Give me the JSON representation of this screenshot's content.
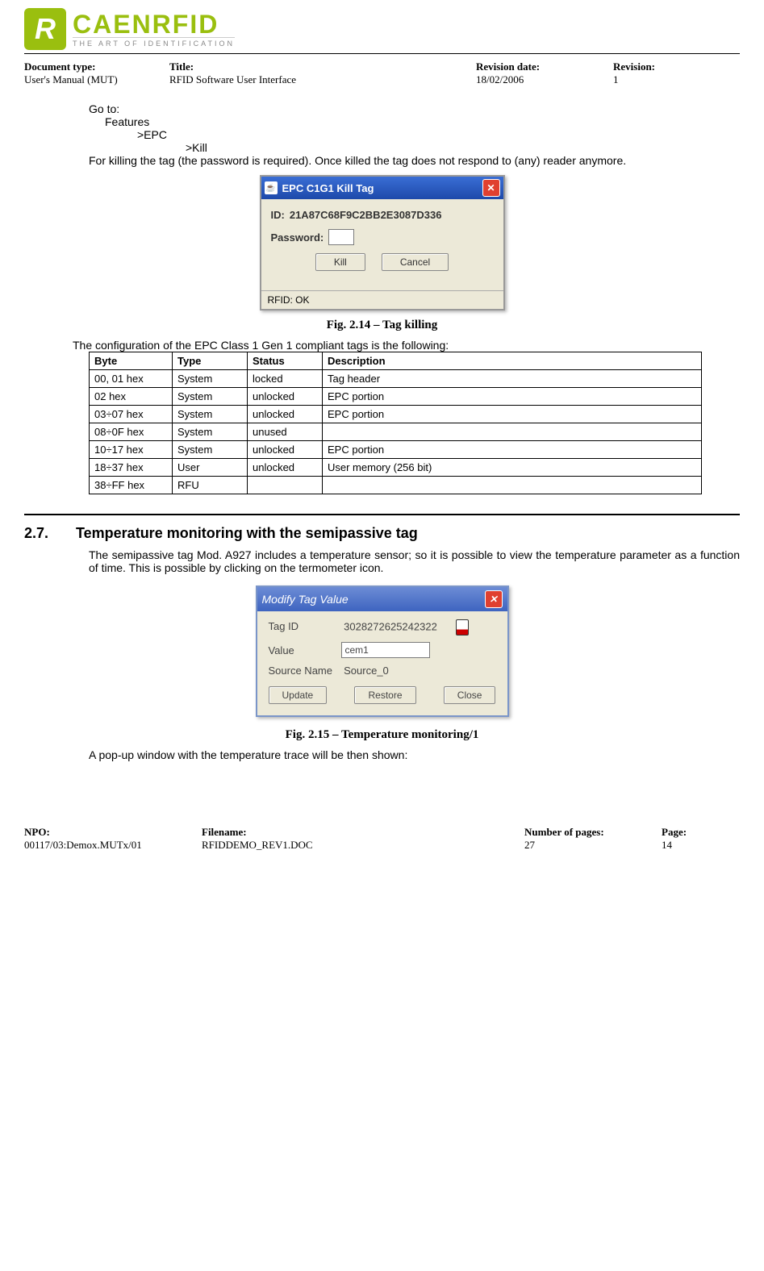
{
  "logo": {
    "brand": "CAENRFID",
    "tagline": "THE ART OF IDENTIFICATION",
    "badge": "R"
  },
  "docinfo": {
    "doctype_label": "Document type:",
    "doctype_val": "User's Manual (MUT)",
    "title_label": "Title:",
    "title_val": "RFID Software User Interface",
    "revdate_label": "Revision date:",
    "revdate_val": "18/02/2006",
    "rev_label": "Revision:",
    "rev_val": "1"
  },
  "nav": {
    "goto": "Go to:",
    "features": "Features",
    "epc": ">EPC",
    "kill": ">Kill"
  },
  "kill_para": "For killing the tag (the password is required). Once killed the tag does not respond to (any) reader anymore.",
  "dialog1": {
    "title": "EPC C1G1 Kill Tag",
    "id_label": "ID:",
    "id_value": "21A87C68F9C2BB2E3087D336",
    "pw_label": "Password:",
    "kill_btn": "Kill",
    "cancel_btn": "Cancel",
    "status": "RFID: OK"
  },
  "fig214": "Fig. 2.14 – Tag killing",
  "config_intro": "The configuration of the EPC Class 1 Gen 1 compliant tags is the following:",
  "table": {
    "headers": {
      "byte": "Byte",
      "type": "Type",
      "status": "Status",
      "desc": "Description"
    },
    "rows": [
      {
        "byte": "00, 01 hex",
        "type": "System",
        "status": "locked",
        "desc": "Tag header"
      },
      {
        "byte": "02 hex",
        "type": "System",
        "status": "unlocked",
        "desc": "EPC portion"
      },
      {
        "byte": "03÷07 hex",
        "type": "System",
        "status": "unlocked",
        "desc": "EPC portion"
      },
      {
        "byte": "08÷0F hex",
        "type": "System",
        "status": "unused",
        "desc": ""
      },
      {
        "byte": "10÷17 hex",
        "type": "System",
        "status": "unlocked",
        "desc": "EPC portion"
      },
      {
        "byte": "18÷37 hex",
        "type": "User",
        "status": "unlocked",
        "desc": "User memory (256 bit)"
      },
      {
        "byte": "38÷FF hex",
        "type": "RFU",
        "status": "",
        "desc": ""
      }
    ]
  },
  "section27": {
    "num": "2.7.",
    "title": "Temperature monitoring with the semipassive tag",
    "para": "The semipassive tag Mod. A927 includes a temperature sensor; so it is possible to view the temperature parameter as a function of time. This is possible by clicking on the termometer icon."
  },
  "dialog2": {
    "title": "Modify Tag Value",
    "tagid_label": "Tag ID",
    "tagid_value": "3028272625242322",
    "value_label": "Value",
    "value_value": "cem1",
    "src_label": "Source Name",
    "src_value": "Source_0",
    "update_btn": "Update",
    "restore_btn": "Restore",
    "close_btn": "Close"
  },
  "fig215": "Fig. 2.15 – Temperature monitoring/1",
  "popup_para": "A pop-up window with the temperature trace will be then shown:",
  "footer": {
    "npo_label": "NPO:",
    "npo_val": "00117/03:Demox.MUTx/01",
    "filename_label": "Filename:",
    "filename_val": "RFIDDEMO_REV1.DOC",
    "numpages_label": "Number of pages:",
    "numpages_val": "27",
    "page_label": "Page:",
    "page_val": "14"
  }
}
